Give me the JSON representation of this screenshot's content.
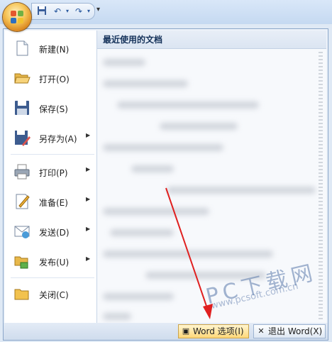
{
  "qat": {
    "icons": [
      "save-icon",
      "undo-icon",
      "redo-icon",
      "dropdown-icon"
    ]
  },
  "menu": {
    "left_items": [
      {
        "label": "新建(N)",
        "icon": "new-document-icon",
        "submenu": false
      },
      {
        "label": "打开(O)",
        "icon": "open-folder-icon",
        "submenu": false
      },
      {
        "label": "保存(S)",
        "icon": "save-icon",
        "submenu": false
      },
      {
        "label": "另存为(A)",
        "icon": "save-as-icon",
        "submenu": true
      },
      {
        "label": "打印(P)",
        "icon": "printer-icon",
        "submenu": true
      },
      {
        "label": "准备(E)",
        "icon": "prepare-icon",
        "submenu": true
      },
      {
        "label": "发送(D)",
        "icon": "send-icon",
        "submenu": true
      },
      {
        "label": "发布(U)",
        "icon": "publish-icon",
        "submenu": true
      },
      {
        "label": "关闭(C)",
        "icon": "close-folder-icon",
        "submenu": false
      }
    ],
    "recent_title": "最近使用的文档"
  },
  "bottom": {
    "options_label": "Word 选项(I)",
    "exit_label": "退出 Word(X)"
  },
  "watermark": {
    "text": "PC下载网",
    "url": "www.pcsoft.com.cn"
  },
  "colors": {
    "accent": "#2b5aa0",
    "highlight": "#ffd879",
    "annotation_arrow": "#e02020"
  }
}
